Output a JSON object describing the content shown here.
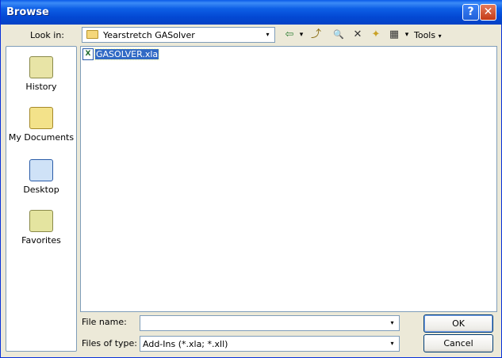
{
  "window": {
    "title": "Browse"
  },
  "titlebar": {
    "help_glyph": "?",
    "close_glyph": "✕"
  },
  "lookin": {
    "label": "Look in:",
    "value": "Yearstretch GASolver"
  },
  "toolbar": {
    "back_glyph": "⇦",
    "dropdown_glyph": "▾",
    "up_glyph": "⤴",
    "search_web_glyph": "🔍",
    "delete_glyph": "✕",
    "new_folder_glyph": "✦",
    "views_glyph": "▦",
    "tools_label": "Tools"
  },
  "places": [
    {
      "label": "History",
      "icon": "history-icon"
    },
    {
      "label": "My Documents",
      "icon": "my-documents-icon"
    },
    {
      "label": "Desktop",
      "icon": "desktop-icon"
    },
    {
      "label": "Favorites",
      "icon": "favorites-icon"
    }
  ],
  "files": [
    {
      "name": "GASOLVER.xla",
      "icon": "excel-addin-icon",
      "selected": true
    }
  ],
  "filename": {
    "label": "File name:",
    "value": ""
  },
  "filetype": {
    "label": "Files of type:",
    "value": "Add-Ins (*.xla; *.xll)"
  },
  "buttons": {
    "ok": "OK",
    "cancel": "Cancel"
  },
  "colors": {
    "titlebar": "#0A5AE8",
    "selection": "#316AC5",
    "face": "#ECE9D8"
  }
}
